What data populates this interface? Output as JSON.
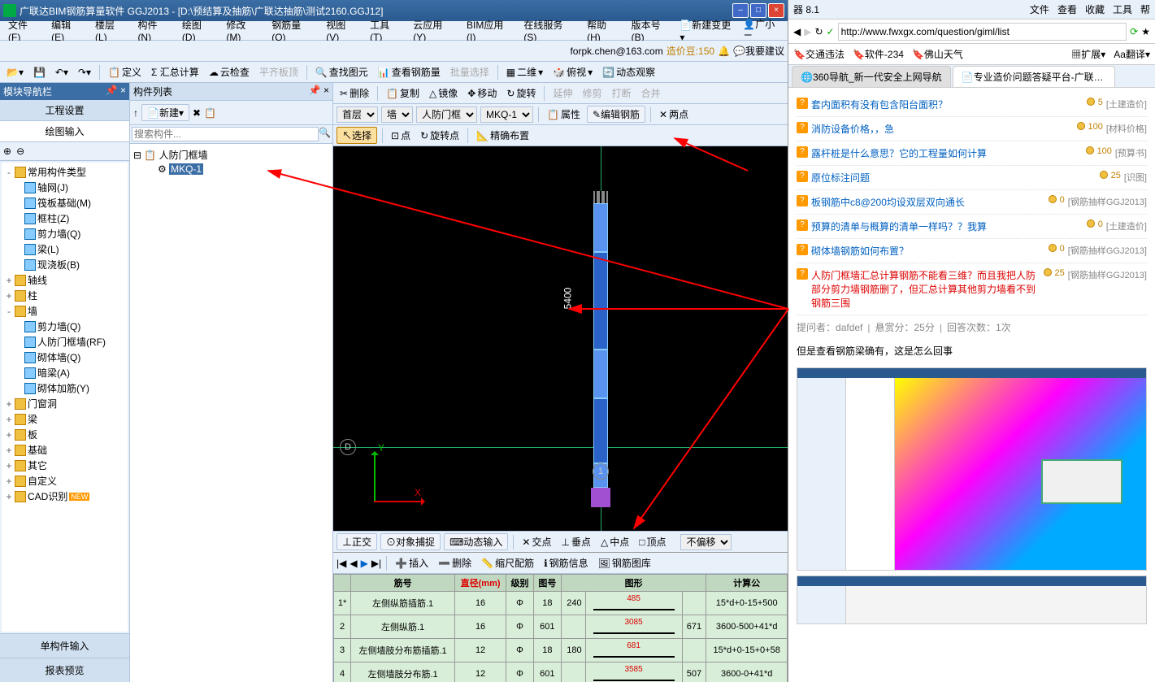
{
  "app": {
    "title": "广联达BIM钢筋算量软件 GGJ2013 - [D:\\预结算及抽筋\\广联达抽筋\\测试2160.GGJ12]",
    "menus": [
      "文件(F)",
      "编辑(E)",
      "楼层(L)",
      "构件(N)",
      "绘图(D)",
      "修改(M)",
      "钢筋量(Q)",
      "视图(V)",
      "工具(T)",
      "云应用(Y)",
      "BIM应用(I)",
      "在线服务(S)",
      "帮助(H)",
      "版本号(B)"
    ],
    "new_change": "新建变更",
    "user_ctrl": "广小二",
    "email": "forpk.chen@163.com",
    "coin_label": "造价豆:150",
    "suggest": "我要建议",
    "tb1": {
      "define": "定义",
      "sum": "Σ 汇总计算",
      "cloud": "云检查",
      "flat": "平齐板顶",
      "find": "查找图元",
      "view_rebar": "查看钢筋量",
      "batch": "批量选择",
      "two_d": "二维",
      "lookdown": "俯视",
      "dyn": "动态观察"
    },
    "tb2": {
      "del": "删除",
      "copy": "复制",
      "mirror": "镜像",
      "move": "移动",
      "rotate": "旋转",
      "extend": "延伸",
      "trim": "修剪",
      "break": "打断",
      "merge": "合并"
    },
    "tb3": {
      "floor": "首层",
      "cat": "墙",
      "type": "人防门框",
      "comp": "MKQ-1",
      "prop": "属性",
      "edit_rebar": "编辑钢筋",
      "two_pt": "两点"
    },
    "tb4": {
      "select": "选择",
      "point": "点",
      "rot_point": "旋转点",
      "exact": "精确布置"
    },
    "canvas": {
      "dim": "5400",
      "axis_x": "X",
      "axis_y": "Y",
      "grid_d": "D",
      "grid_1": "1"
    },
    "status": {
      "ortho": "正交",
      "snap": "对象捕捉",
      "dyn": "动态输入",
      "cross": "交点",
      "perp": "垂点",
      "mid": "中点",
      "vertex": "顶点",
      "offset": "不偏移"
    },
    "table_tb": {
      "insert": "插入",
      "del": "删除",
      "scale": "缩尺配筋",
      "info": "钢筋信息",
      "gallery": "钢筋图库"
    },
    "table": {
      "headers": [
        "",
        "筋号",
        "直径(mm)",
        "级别",
        "图号",
        "",
        "图形",
        "",
        "计算公"
      ],
      "rows": [
        {
          "n": "1*",
          "name": "左侧纵筋插筋.1",
          "dia": "16",
          "lvl": "Φ",
          "pic": "18",
          "v1": "240",
          "shape": "485",
          "v2": "",
          "formula": "15*d+0-15+500"
        },
        {
          "n": "2",
          "name": "左侧纵筋.1",
          "dia": "16",
          "lvl": "Φ",
          "pic": "601",
          "v1": "",
          "shape": "3085",
          "v2": "671",
          "formula": "3600-500+41*d"
        },
        {
          "n": "3",
          "name": "左侧墙肢分布筋插筋.1",
          "dia": "12",
          "lvl": "Φ",
          "pic": "18",
          "v1": "180",
          "shape": "681",
          "v2": "",
          "formula": "15*d+0-15+0+58"
        },
        {
          "n": "4",
          "name": "左侧墙肢分布筋.1",
          "dia": "12",
          "lvl": "Φ",
          "pic": "601",
          "v1": "",
          "shape": "3585",
          "v2": "507",
          "formula": "3600-0+41*d"
        }
      ]
    }
  },
  "nav": {
    "title": "模块导航栏",
    "tab1": "工程设置",
    "tab2": "绘图输入",
    "nodes": {
      "common": "常用构件类型",
      "axis_net": "轴网(J)",
      "raft": "筏板基础(M)",
      "frame_col": "框柱(Z)",
      "shear_wall": "剪力墙(Q)",
      "beam": "梁(L)",
      "cast_slab": "现浇板(B)",
      "axis_line": "轴线",
      "col": "柱",
      "wall": "墙",
      "shear_wall_q": "剪力墙(Q)",
      "rf_wall": "人防门框墙(RF)",
      "brick_wall": "砌体墙(Q)",
      "hidden_beam": "暗梁(A)",
      "brick_rein": "砌体加筋(Y)",
      "door_win": "门窗洞",
      "beam2": "梁",
      "slab": "板",
      "found": "基础",
      "other": "其它",
      "custom": "自定义",
      "cad": "CAD识别",
      "new_badge": "NEW"
    },
    "bottom1": "单构件输入",
    "bottom2": "报表预览"
  },
  "comp": {
    "title": "构件列表",
    "new": "新建",
    "search_ph": "搜索构件...",
    "root": "人防门框墙",
    "item": "MKQ-1"
  },
  "browser": {
    "top_right": "器 8.1",
    "top_menus": [
      "文件",
      "查看",
      "收藏",
      "工具",
      "帮"
    ],
    "url": "http://www.fwxgx.com/question/giml/list",
    "bookmarks": [
      "交通违法",
      "软件-234",
      "佛山天气"
    ],
    "ext": "扩展",
    "trans": "翻译",
    "tabs": [
      "360导航_新一代安全上网导航",
      "专业造价问题答疑平台-广联达服"
    ],
    "questions": [
      {
        "text": "套内面积有没有包含阳台面积？",
        "coin": "5",
        "cat": "[土建造价]"
      },
      {
        "text": "消防设备价格，，急",
        "coin": "100",
        "cat": "[材料价格]"
      },
      {
        "text": "露杆桩是什么意思？它的工程量如何计算",
        "coin": "100",
        "cat": "[预算书]"
      },
      {
        "text": "原位标注问题",
        "coin": "25",
        "cat": "[识图]"
      },
      {
        "text": "板钢筋中c8@200均设双层双向通长",
        "coin": "0",
        "cat": "[钢筋抽样GGJ2013]"
      },
      {
        "text": "预算的清单与概算的清单一样吗？？我算",
        "coin": "0",
        "cat": "[土建造价]"
      },
      {
        "text": "砌体墙钢筋如何布置？",
        "coin": "0",
        "cat": "[钢筋抽样GGJ2013]"
      }
    ],
    "highlighted": {
      "text": "人防门框墙汇总计算钢筋不能看三维？而且我把人防部分剪力墙钢筋删了，但汇总计算其他剪力墙看不到钢筋三围",
      "coin": "25",
      "cat": "[钢筋抽样GGJ2013]"
    },
    "meta": {
      "asker_label": "提问者：",
      "asker": "dafdef",
      "bounty_label": "悬赏分：",
      "bounty": "25分",
      "answers_label": "回答次数：",
      "answers": "1次"
    },
    "body": "但是查看钢筋梁确有，这是怎么回事"
  }
}
